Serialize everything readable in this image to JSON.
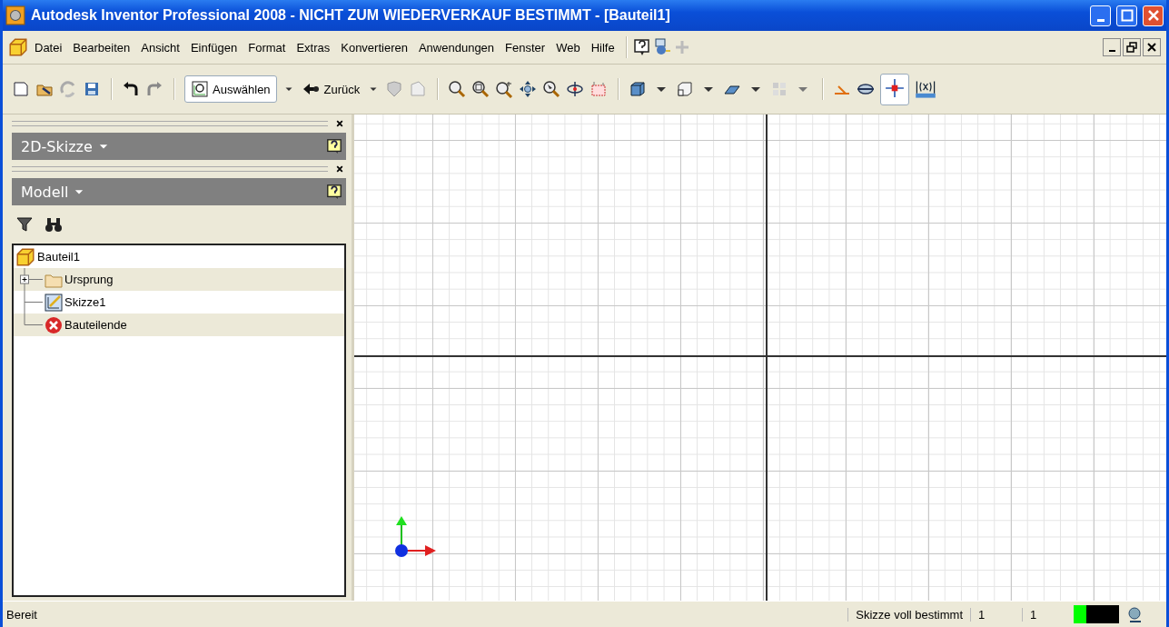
{
  "window": {
    "title": "Autodesk Inventor Professional 2008 - NICHT ZUM WIEDERVERKAUF BESTIMMT - [Bauteil1]"
  },
  "menu": [
    "Datei",
    "Bearbeiten",
    "Ansicht",
    "Einfügen",
    "Format",
    "Extras",
    "Konvertieren",
    "Anwendungen",
    "Fenster",
    "Web",
    "Hilfe"
  ],
  "toolbar": {
    "select_button": "Auswählen",
    "back_button": "Zurück"
  },
  "panels": [
    {
      "title": "2D-Skizze"
    },
    {
      "title": "Modell"
    }
  ],
  "tree": {
    "label": "Bauteil1",
    "children": [
      {
        "label": "Ursprung",
        "kind": "folder",
        "expanded": false
      },
      {
        "label": "Skizze1",
        "kind": "sketch"
      },
      {
        "label": "Bauteilende",
        "kind": "end"
      }
    ]
  },
  "status_bar": {
    "message": "Bereit",
    "sketch_state": "Skizze voll bestimmt",
    "field_1": "1",
    "field_2": "1"
  }
}
